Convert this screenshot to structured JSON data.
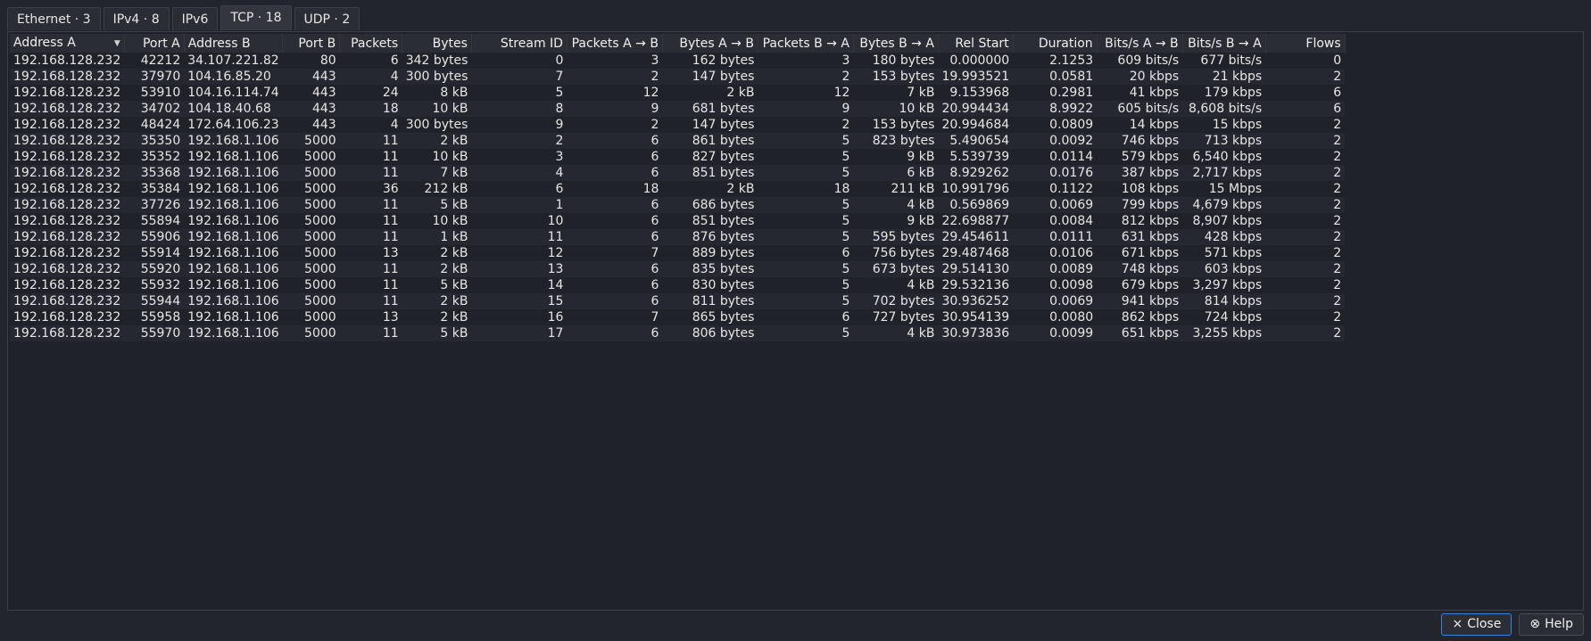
{
  "tabs": [
    {
      "label": "Ethernet · 3"
    },
    {
      "label": "IPv4 · 8"
    },
    {
      "label": "IPv6"
    },
    {
      "label": "TCP · 18"
    },
    {
      "label": "UDP · 2"
    }
  ],
  "active_tab": "TCP · 18",
  "sorted_column": "Address A",
  "columns": [
    "Address A",
    "Port A",
    "Address B",
    "Port B",
    "Packets",
    "Bytes",
    "Stream ID",
    "Packets A → B",
    "Bytes A → B",
    "Packets B → A",
    "Bytes B → A",
    "Rel Start",
    "Duration",
    "Bits/s A → B",
    "Bits/s B → A",
    "Flows"
  ],
  "rows": [
    [
      "192.168.128.232",
      "42212",
      "34.107.221.82",
      "80",
      "6",
      "342 bytes",
      "0",
      "3",
      "162 bytes",
      "3",
      "180 bytes",
      "0.000000",
      "2.1253",
      "609 bits/s",
      "677 bits/s",
      "0"
    ],
    [
      "192.168.128.232",
      "37970",
      "104.16.85.20",
      "443",
      "4",
      "300 bytes",
      "7",
      "2",
      "147 bytes",
      "2",
      "153 bytes",
      "19.993521",
      "0.0581",
      "20 kbps",
      "21 kbps",
      "2"
    ],
    [
      "192.168.128.232",
      "53910",
      "104.16.114.74",
      "443",
      "24",
      "8 kB",
      "5",
      "12",
      "2 kB",
      "12",
      "7 kB",
      "9.153968",
      "0.2981",
      "41 kbps",
      "179 kbps",
      "6"
    ],
    [
      "192.168.128.232",
      "34702",
      "104.18.40.68",
      "443",
      "18",
      "10 kB",
      "8",
      "9",
      "681 bytes",
      "9",
      "10 kB",
      "20.994434",
      "8.9922",
      "605 bits/s",
      "8,608 bits/s",
      "6"
    ],
    [
      "192.168.128.232",
      "48424",
      "172.64.106.23",
      "443",
      "4",
      "300 bytes",
      "9",
      "2",
      "147 bytes",
      "2",
      "153 bytes",
      "20.994684",
      "0.0809",
      "14 kbps",
      "15 kbps",
      "2"
    ],
    [
      "192.168.128.232",
      "35350",
      "192.168.1.106",
      "5000",
      "11",
      "2 kB",
      "2",
      "6",
      "861 bytes",
      "5",
      "823 bytes",
      "5.490654",
      "0.0092",
      "746 kbps",
      "713 kbps",
      "2"
    ],
    [
      "192.168.128.232",
      "35352",
      "192.168.1.106",
      "5000",
      "11",
      "10 kB",
      "3",
      "6",
      "827 bytes",
      "5",
      "9 kB",
      "5.539739",
      "0.0114",
      "579 kbps",
      "6,540 kbps",
      "2"
    ],
    [
      "192.168.128.232",
      "35368",
      "192.168.1.106",
      "5000",
      "11",
      "7 kB",
      "4",
      "6",
      "851 bytes",
      "5",
      "6 kB",
      "8.929262",
      "0.0176",
      "387 kbps",
      "2,717 kbps",
      "2"
    ],
    [
      "192.168.128.232",
      "35384",
      "192.168.1.106",
      "5000",
      "36",
      "212 kB",
      "6",
      "18",
      "2 kB",
      "18",
      "211 kB",
      "10.991796",
      "0.1122",
      "108 kbps",
      "15 Mbps",
      "2"
    ],
    [
      "192.168.128.232",
      "37726",
      "192.168.1.106",
      "5000",
      "11",
      "5 kB",
      "1",
      "6",
      "686 bytes",
      "5",
      "4 kB",
      "0.569869",
      "0.0069",
      "799 kbps",
      "4,679 kbps",
      "2"
    ],
    [
      "192.168.128.232",
      "55894",
      "192.168.1.106",
      "5000",
      "11",
      "10 kB",
      "10",
      "6",
      "851 bytes",
      "5",
      "9 kB",
      "22.698877",
      "0.0084",
      "812 kbps",
      "8,907 kbps",
      "2"
    ],
    [
      "192.168.128.232",
      "55906",
      "192.168.1.106",
      "5000",
      "11",
      "1 kB",
      "11",
      "6",
      "876 bytes",
      "5",
      "595 bytes",
      "29.454611",
      "0.0111",
      "631 kbps",
      "428 kbps",
      "2"
    ],
    [
      "192.168.128.232",
      "55914",
      "192.168.1.106",
      "5000",
      "13",
      "2 kB",
      "12",
      "7",
      "889 bytes",
      "6",
      "756 bytes",
      "29.487468",
      "0.0106",
      "671 kbps",
      "571 kbps",
      "2"
    ],
    [
      "192.168.128.232",
      "55920",
      "192.168.1.106",
      "5000",
      "11",
      "2 kB",
      "13",
      "6",
      "835 bytes",
      "5",
      "673 bytes",
      "29.514130",
      "0.0089",
      "748 kbps",
      "603 kbps",
      "2"
    ],
    [
      "192.168.128.232",
      "55932",
      "192.168.1.106",
      "5000",
      "11",
      "5 kB",
      "14",
      "6",
      "830 bytes",
      "5",
      "4 kB",
      "29.532136",
      "0.0098",
      "679 kbps",
      "3,297 kbps",
      "2"
    ],
    [
      "192.168.128.232",
      "55944",
      "192.168.1.106",
      "5000",
      "11",
      "2 kB",
      "15",
      "6",
      "811 bytes",
      "5",
      "702 bytes",
      "30.936252",
      "0.0069",
      "941 kbps",
      "814 kbps",
      "2"
    ],
    [
      "192.168.128.232",
      "55958",
      "192.168.1.106",
      "5000",
      "13",
      "2 kB",
      "16",
      "7",
      "865 bytes",
      "6",
      "727 bytes",
      "30.954139",
      "0.0080",
      "862 kbps",
      "724 kbps",
      "2"
    ],
    [
      "192.168.128.232",
      "55970",
      "192.168.1.106",
      "5000",
      "11",
      "5 kB",
      "17",
      "6",
      "806 bytes",
      "5",
      "4 kB",
      "30.973836",
      "0.0099",
      "651 kbps",
      "3,255 kbps",
      "2"
    ]
  ],
  "buttons": {
    "close_label": "Close",
    "close_icon": "×",
    "help_label": "Help",
    "help_icon": "⊗"
  }
}
